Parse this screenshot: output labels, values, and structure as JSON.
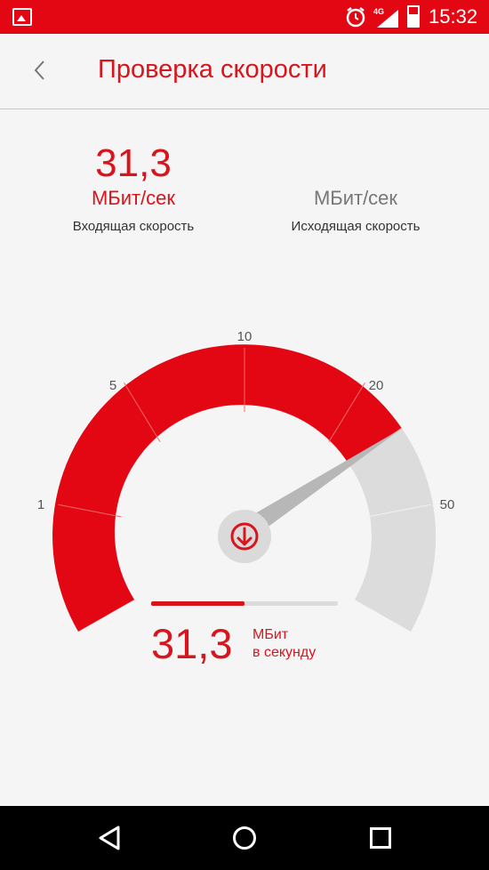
{
  "status_bar": {
    "network": "4G",
    "time": "15:32",
    "battery_level": 0.6
  },
  "header": {
    "title": "Проверка скорости",
    "back_icon": "chevron-left-icon"
  },
  "download": {
    "value": "31,3",
    "unit": "МБит/сек",
    "label": "Входящая скорость"
  },
  "upload": {
    "value": "",
    "unit": "МБит/сек",
    "label": "Исходящая скорость"
  },
  "gauge": {
    "ticks": [
      "1",
      "5",
      "10",
      "20",
      "50"
    ],
    "current_value": 31.3,
    "center_icon": "download-arrow-icon",
    "colors": {
      "active": "#e30613",
      "inactive": "#dcdcdc"
    }
  },
  "readout": {
    "value": "31,3",
    "unit_line1": "МБит",
    "unit_line2": "в секунду",
    "progress": 0.5
  },
  "nav": {
    "back_icon": "triangle-back-icon",
    "home_icon": "circle-home-icon",
    "recent_icon": "square-recent-icon"
  }
}
